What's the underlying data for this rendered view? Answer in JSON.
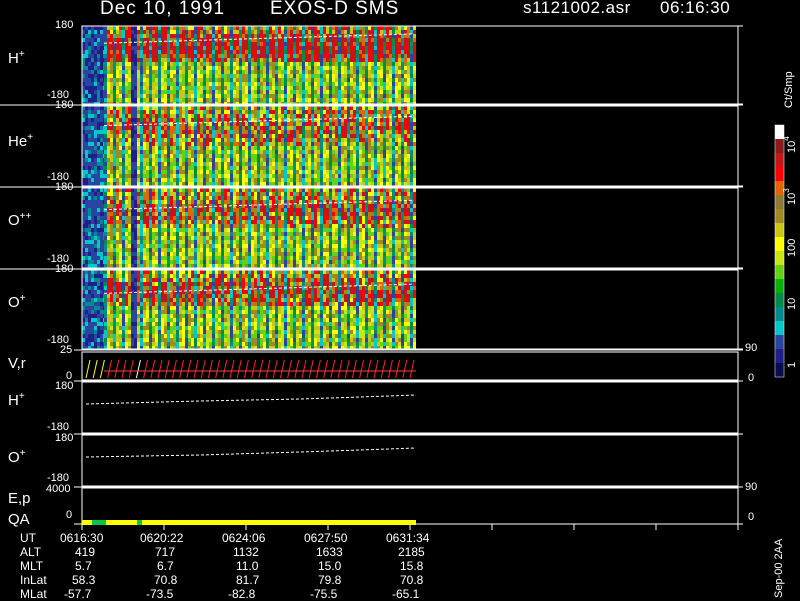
{
  "header": {
    "date": "Dec 10, 1991",
    "mission": "EXOS-D SMS",
    "file": "s1121002.asr",
    "time": "06:16:30"
  },
  "panels": {
    "h_plus": {
      "name": "H",
      "sup": "+",
      "ymax": "180",
      "ymin": "-180"
    },
    "he_plus": {
      "name": "He",
      "sup": "+",
      "ymax": "180",
      "ymin": "-180"
    },
    "o_pp": {
      "name": "O",
      "sup": "++",
      "ymax": "180",
      "ymin": "-180"
    },
    "o_plus": {
      "name": "O",
      "sup": "+",
      "ymax": "180",
      "ymin": "-180"
    },
    "vr": {
      "name": "V,r",
      "ymax": "25",
      "ymin": "0",
      "rmax": "90",
      "rmin": "0"
    },
    "h_plus_line": {
      "name": "H",
      "sup": "+",
      "ymax": "180",
      "ymin": "-180"
    },
    "o_plus_line": {
      "name": "O",
      "sup": "+",
      "ymax": "180",
      "ymin": "-180"
    },
    "ep": {
      "name": "E,p",
      "ymax": "4000",
      "ymin": "0",
      "rmax": "90",
      "rmin": "0"
    },
    "qa": {
      "name": "QA"
    }
  },
  "colorbar": {
    "unit": "Ct/Smp",
    "labels": [
      "10",
      "4",
      "10",
      "3",
      "100",
      "10",
      "1"
    ],
    "colors": [
      "#ffffff",
      "#8c1a1a",
      "#c81414",
      "#ff0000",
      "#e66400",
      "#8c7a32",
      "#a08c1e",
      "#c8c814",
      "#ffff00",
      "#c8e614",
      "#64d214",
      "#00b400",
      "#008c46",
      "#008c8c",
      "#00c8c8",
      "#2846a0",
      "#1e1e8c",
      "#0a0a50"
    ]
  },
  "time_axis": {
    "rows": [
      {
        "label": "UT",
        "values": [
          "0616:30",
          "0620:22",
          "0624:06",
          "0627:50",
          "0631:34"
        ]
      },
      {
        "label": "ALT",
        "values": [
          "419",
          "717",
          "1132",
          "1633",
          "2185"
        ]
      },
      {
        "label": "MLT",
        "values": [
          "5.7",
          "6.7",
          "11.0",
          "15.0",
          "15.8"
        ]
      },
      {
        "label": "InLat",
        "values": [
          "58.3",
          "70.8",
          "81.7",
          "79.8",
          "70.8"
        ]
      },
      {
        "label": "MLat",
        "values": [
          "-57.7",
          "-73.5",
          "-82.8",
          "-75.5",
          "-65.1"
        ]
      }
    ]
  },
  "footer_stamp": "Sep-00 2AA",
  "chart_data": {
    "type": "heatmap",
    "title": "Dec 10, 1991   EXOS-D SMS",
    "x": [
      "0616:30",
      "0620:22",
      "0624:06",
      "0627:50",
      "0631:34"
    ],
    "series": [
      {
        "name": "H+",
        "ylim": [
          -180,
          180
        ]
      },
      {
        "name": "He+",
        "ylim": [
          -180,
          180
        ]
      },
      {
        "name": "O++",
        "ylim": [
          -180,
          180
        ]
      },
      {
        "name": "O+",
        "ylim": [
          -180,
          180
        ]
      }
    ],
    "colorscale": {
      "unit": "Ct/Smp",
      "range": [
        1,
        10000
      ],
      "scale": "log"
    },
    "line_panels": [
      {
        "name": "H+",
        "ylim": [
          -180,
          180
        ]
      },
      {
        "name": "O+",
        "ylim": [
          -180,
          180
        ]
      }
    ]
  }
}
